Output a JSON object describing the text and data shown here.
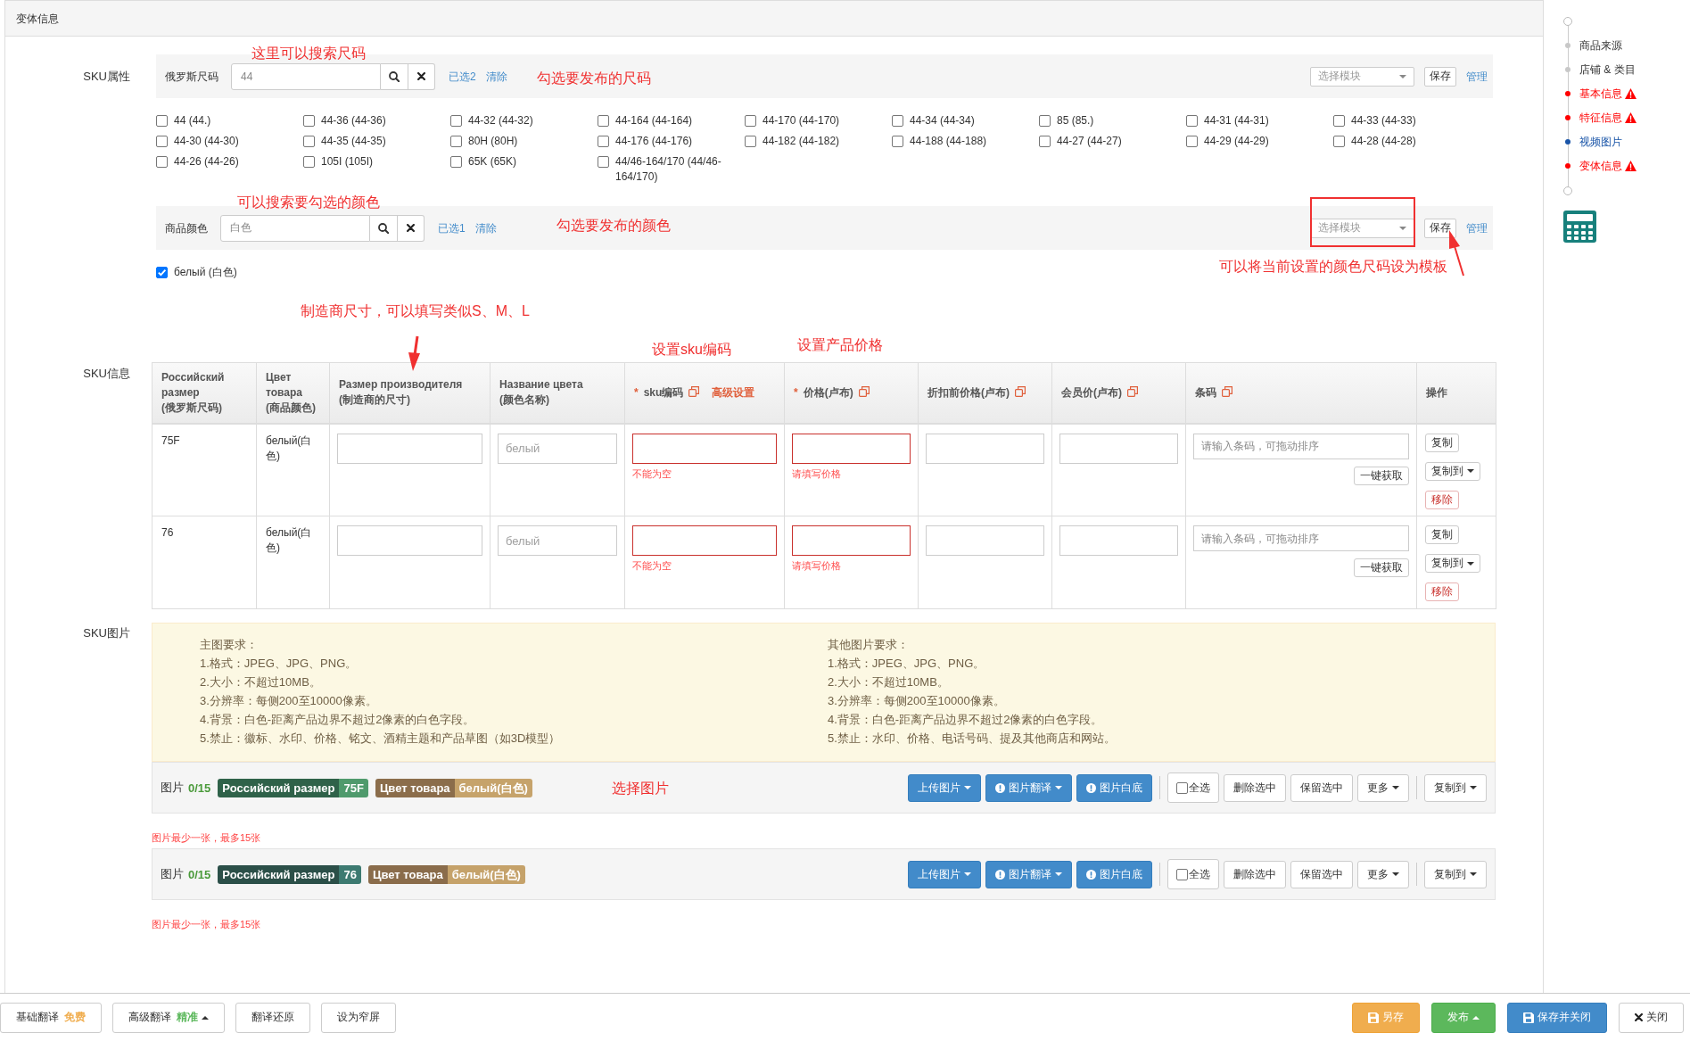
{
  "panel": {
    "title": "变体信息"
  },
  "sku_attributes": {
    "label": "SKU属性",
    "groups": [
      {
        "label": "俄罗斯尺码",
        "search": {
          "value": "44"
        },
        "selected_count": "已选2",
        "clear": "清除",
        "template": {
          "placeholder": "选择模块"
        },
        "save": "保存",
        "manage": "管理",
        "options": [
          {
            "label": "44 (44.)",
            "checked": false
          },
          {
            "label": "44-36 (44-36)",
            "checked": false
          },
          {
            "label": "44-32 (44-32)",
            "checked": false
          },
          {
            "label": "44-164 (44-164)",
            "checked": false
          },
          {
            "label": "44-170 (44-170)",
            "checked": false
          },
          {
            "label": "44-34 (44-34)",
            "checked": false
          },
          {
            "label": "85 (85.)",
            "checked": false
          },
          {
            "label": "44-31 (44-31)",
            "checked": false
          },
          {
            "label": "44-33 (44-33)",
            "checked": false
          },
          {
            "label": "44-30 (44-30)",
            "checked": false
          },
          {
            "label": "44-35 (44-35)",
            "checked": false
          },
          {
            "label": "80H (80H)",
            "checked": false
          },
          {
            "label": "44-176 (44-176)",
            "checked": false
          },
          {
            "label": "44-182 (44-182)",
            "checked": false
          },
          {
            "label": "44-188 (44-188)",
            "checked": false
          },
          {
            "label": "44-27 (44-27)",
            "checked": false
          },
          {
            "label": "44-29 (44-29)",
            "checked": false
          },
          {
            "label": "44-28 (44-28)",
            "checked": false
          },
          {
            "label": "44-26 (44-26)",
            "checked": false
          },
          {
            "label": "105I (105I)",
            "checked": false
          },
          {
            "label": "65K (65K)",
            "checked": false
          },
          {
            "label": "44/46-164/170 (44/46-164/170)",
            "checked": false
          }
        ]
      },
      {
        "label": "商品颜色",
        "search": {
          "value": "白色"
        },
        "selected_count": "已选1",
        "clear": "清除",
        "template": {
          "placeholder": "选择模块"
        },
        "save": "保存",
        "manage": "管理",
        "options": [
          {
            "label": "белый (白色)",
            "checked": true
          }
        ]
      }
    ]
  },
  "sku_info": {
    "label": "SKU信息",
    "columns": [
      {
        "label": "Российский размер (俄罗斯尺码)",
        "copyable": false
      },
      {
        "label": "Цвет товара (商品颜色)",
        "copyable": false
      },
      {
        "label": "Размер производителя (制造商的尺寸)",
        "copyable": false
      },
      {
        "label": "Название цвета (颜色名称)",
        "copyable": false
      },
      {
        "required_mark": "*",
        "label": "sku编码",
        "copyable": true,
        "link": "高级设置"
      },
      {
        "required_mark": "*",
        "label": "价格(卢布)",
        "copyable": true
      },
      {
        "label": "折扣前价格(卢布)",
        "copyable": true
      },
      {
        "label": "会员价(卢布)",
        "copyable": true
      },
      {
        "label": "条码",
        "copyable": true
      },
      {
        "label": "操作",
        "copyable": false
      }
    ],
    "rows": [
      {
        "cells": [
          {
            "kind": "text",
            "text": "75F"
          },
          {
            "kind": "text",
            "text": "белый(白色)"
          },
          {
            "kind": "input",
            "invalid": false
          },
          {
            "kind": "input",
            "placeholder": "белый",
            "invalid": false
          },
          {
            "kind": "input",
            "invalid": true,
            "error": "不能为空"
          },
          {
            "kind": "input",
            "invalid": true,
            "error": "请填写价格"
          },
          {
            "kind": "input",
            "invalid": false
          },
          {
            "kind": "input",
            "invalid": false
          },
          {
            "kind": "barcode",
            "placeholder": "请输入条码，可拖动排序",
            "button": "一键获取"
          },
          {
            "kind": "actions",
            "buttons": [
              {
                "label": "复制",
                "kind": "default",
                "menu": false
              },
              {
                "label": "复制到",
                "kind": "default",
                "menu": true
              },
              {
                "label": "移除",
                "kind": "danger",
                "menu": false
              }
            ]
          }
        ]
      },
      {
        "cells": [
          {
            "kind": "text",
            "text": "76"
          },
          {
            "kind": "text",
            "text": "белый(白色)"
          },
          {
            "kind": "input",
            "invalid": false
          },
          {
            "kind": "input",
            "placeholder": "белый",
            "invalid": false
          },
          {
            "kind": "input",
            "invalid": true,
            "error": "不能为空"
          },
          {
            "kind": "input",
            "invalid": true,
            "error": "请填写价格"
          },
          {
            "kind": "input",
            "invalid": false
          },
          {
            "kind": "input",
            "invalid": false
          },
          {
            "kind": "barcode",
            "placeholder": "请输入条码，可拖动排序",
            "button": "一键获取"
          },
          {
            "kind": "actions",
            "buttons": [
              {
                "label": "复制",
                "kind": "default",
                "menu": false
              },
              {
                "label": "复制到",
                "kind": "default",
                "menu": true
              },
              {
                "label": "移除",
                "kind": "danger",
                "menu": false
              }
            ]
          }
        ]
      }
    ]
  },
  "sku_images": {
    "label": "SKU图片",
    "requirements": [
      {
        "title": "主图要求：",
        "lines": [
          "1.格式：JPEG、JPG、PNG。",
          "2.大小：不超过10MB。",
          "3.分辨率：每侧200至10000像素。",
          "4.背景：白色-距离产品边界不超过2像素的白色字段。",
          "5.禁止：徽标、水印、价格、铭文、酒精主题和产品草图（如3D模型）"
        ]
      },
      {
        "title": "其他图片要求：",
        "lines": [
          "1.格式：JPEG、JPG、PNG。",
          "2.大小：不超过10MB。",
          "3.分辨率：每侧200至10000像素。",
          "4.背景：白色-距离产品边界不超过2像素的白色字段。",
          "5.禁止：水印、价格、电话号码、提及其他商店和网站。"
        ]
      }
    ],
    "rows": [
      {
        "label": "图片",
        "count": "0/15",
        "tags": [
          {
            "name": {
              "text": "Российский размер",
              "color": "#2f6249"
            },
            "value": {
              "text": "75F",
              "color": "#4f9a6c"
            }
          },
          {
            "name": {
              "text": "Цвет товара",
              "color": "#8b6d4b"
            },
            "value": {
              "text": "белый(白色)",
              "color": "#c6a36b"
            }
          }
        ],
        "button_groups": [
          [
            {
              "label": "上传图片",
              "kind": "primary",
              "menu": true
            },
            {
              "label": "图片翻译",
              "kind": "primaryinfo",
              "menu": true
            },
            {
              "label": "图片白底",
              "kind": "primaryinfo",
              "menu": false
            }
          ],
          [
            {
              "label": "全选",
              "kind": "checkbox",
              "checked": false
            },
            {
              "label": "删除选中",
              "kind": "default",
              "menu": false
            },
            {
              "label": "保留选中",
              "kind": "default",
              "menu": false
            },
            {
              "label": "更多",
              "kind": "default",
              "menu": true
            }
          ],
          [
            {
              "label": "复制到",
              "kind": "default",
              "menu": true
            }
          ]
        ],
        "error": "图片最少一张，最多15张"
      },
      {
        "label": "图片",
        "count": "0/15",
        "tags": [
          {
            "name": {
              "text": "Российский размер",
              "color": "#2b4f48"
            },
            "value": {
              "text": "76",
              "color": "#3d7a71"
            }
          },
          {
            "name": {
              "text": "Цвет товара",
              "color": "#8a6c4b"
            },
            "value": {
              "text": "белый(白色)",
              "color": "#c5a26a"
            }
          }
        ],
        "button_groups": [
          [
            {
              "label": "上传图片",
              "kind": "primary",
              "menu": true
            },
            {
              "label": "图片翻译",
              "kind": "primaryinfo",
              "menu": true
            },
            {
              "label": "图片白底",
              "kind": "primaryinfo",
              "menu": false
            }
          ],
          [
            {
              "label": "全选",
              "kind": "checkbox",
              "checked": false
            },
            {
              "label": "删除选中",
              "kind": "default",
              "menu": false
            },
            {
              "label": "保留选中",
              "kind": "default",
              "menu": false
            },
            {
              "label": "更多",
              "kind": "default",
              "menu": true
            }
          ],
          [
            {
              "label": "复制到",
              "kind": "default",
              "menu": true
            }
          ]
        ],
        "error": "图片最少一张，最多15张"
      }
    ]
  },
  "annotations": [
    {
      "text": "这里可以搜索尺码"
    },
    {
      "text": "勾选要发布的尺码"
    },
    {
      "text": "可以搜索要勾选的颜色"
    },
    {
      "text": "勾选要发布的颜色"
    },
    {
      "text": "可以将当前设置的颜色尺码设为模板"
    },
    {
      "text": "制造商尺寸，可以填写类似S、M、L"
    },
    {
      "text": "设置sku编码"
    },
    {
      "text": "设置产品价格"
    },
    {
      "text": "选择图片"
    }
  ],
  "nav": {
    "items": [
      {
        "label": "商品来源",
        "kind": "done"
      },
      {
        "label": "店铺 & 类目",
        "kind": "done"
      },
      {
        "label": "基本信息",
        "kind": "error"
      },
      {
        "label": "特征信息",
        "kind": "error"
      },
      {
        "label": "视频图片",
        "kind": "current"
      },
      {
        "label": "变体信息",
        "kind": "error"
      }
    ]
  },
  "footer": {
    "left": [
      {
        "label": "基础翻译",
        "kind": "plain",
        "note": {
          "text": "免费",
          "color": "#f0ad4e"
        },
        "menu": false
      },
      {
        "label": "高级翻译",
        "kind": "plain",
        "note": {
          "text": "精准",
          "color": "#5cb85c"
        },
        "menu": true
      },
      {
        "label": "翻译还原",
        "kind": "plain",
        "menu": false
      },
      {
        "label": "设为窄屏",
        "kind": "plain",
        "menu": false
      }
    ],
    "right": [
      {
        "label": "另存",
        "kind": "saveas",
        "menu": false
      },
      {
        "label": "发布",
        "kind": "publish",
        "menu": true
      },
      {
        "label": "保存并关闭",
        "kind": "saveclose",
        "menu": false
      },
      {
        "label": "关闭",
        "kind": "close",
        "menu": false
      }
    ]
  }
}
